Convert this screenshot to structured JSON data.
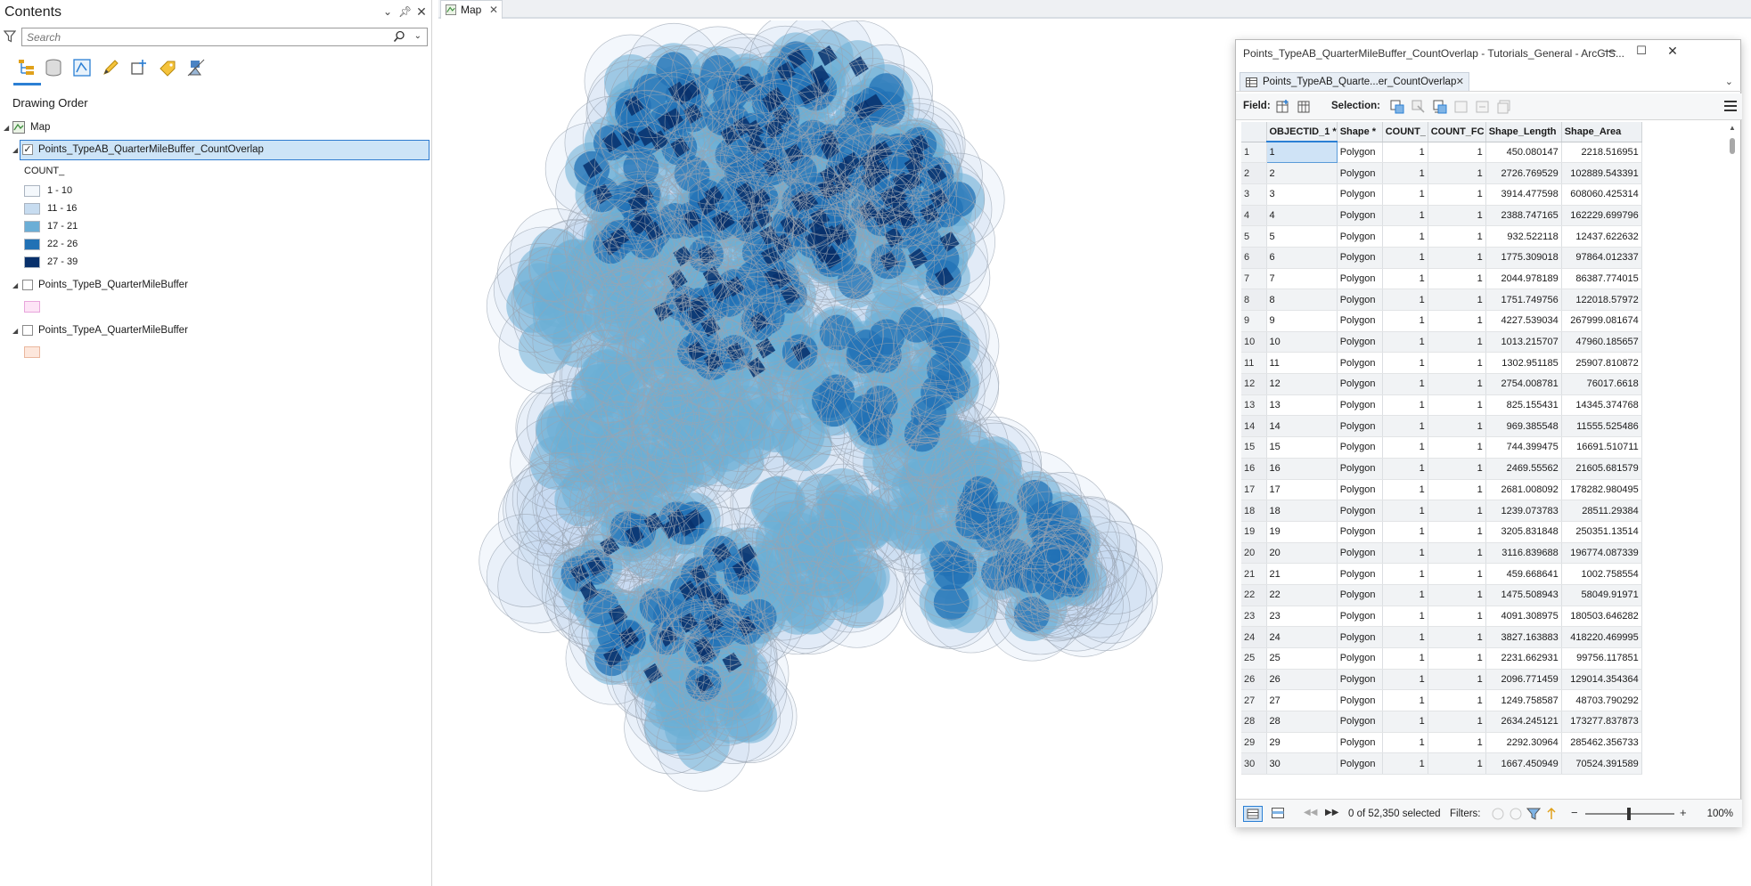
{
  "contents": {
    "title": "Contents",
    "search_placeholder": "Search",
    "section_heading": "Drawing Order",
    "map_label": "Map",
    "layers": [
      {
        "name": "Points_TypeAB_QuarterMileBuffer_CountOverlap",
        "checked": true,
        "selected": true
      },
      {
        "name": "Points_TypeB_QuarterMileBuffer",
        "checked": false,
        "swatch": "#fde4f6"
      },
      {
        "name": "Points_TypeA_QuarterMileBuffer",
        "checked": false,
        "swatch": "#fde7dc"
      }
    ],
    "legend_field": "COUNT_",
    "legend": [
      {
        "label": "1 - 10",
        "color": "#f4f8fc"
      },
      {
        "label": "11 - 16",
        "color": "#c7dcf0"
      },
      {
        "label": "17 - 21",
        "color": "#6baed6"
      },
      {
        "label": "22 - 26",
        "color": "#2171b5"
      },
      {
        "label": "27 - 39",
        "color": "#08306b"
      }
    ]
  },
  "map": {
    "tab_label": "Map"
  },
  "attribute_window": {
    "title": "Points_TypeAB_QuarterMileBuffer_CountOverlap - Tutorials_General - ArcGIS...",
    "tab_label": "Points_TypeAB_Quarte...er_CountOverlap",
    "field_label": "Field:",
    "selection_label": "Selection:",
    "columns": [
      "",
      "OBJECTID_1 *",
      "Shape *",
      "COUNT_",
      "COUNT_FC",
      "Shape_Length",
      "Shape_Area"
    ],
    "rows": [
      [
        "1",
        "1",
        "Polygon",
        "1",
        "1",
        "450.080147",
        "2218.516951"
      ],
      [
        "2",
        "2",
        "Polygon",
        "1",
        "1",
        "2726.769529",
        "102889.543391"
      ],
      [
        "3",
        "3",
        "Polygon",
        "1",
        "1",
        "3914.477598",
        "608060.425314"
      ],
      [
        "4",
        "4",
        "Polygon",
        "1",
        "1",
        "2388.747165",
        "162229.699796"
      ],
      [
        "5",
        "5",
        "Polygon",
        "1",
        "1",
        "932.522118",
        "12437.622632"
      ],
      [
        "6",
        "6",
        "Polygon",
        "1",
        "1",
        "1775.309018",
        "97864.012337"
      ],
      [
        "7",
        "7",
        "Polygon",
        "1",
        "1",
        "2044.978189",
        "86387.774015"
      ],
      [
        "8",
        "8",
        "Polygon",
        "1",
        "1",
        "1751.749756",
        "122018.57972"
      ],
      [
        "9",
        "9",
        "Polygon",
        "1",
        "1",
        "4227.539034",
        "267999.081674"
      ],
      [
        "10",
        "10",
        "Polygon",
        "1",
        "1",
        "1013.215707",
        "47960.185657"
      ],
      [
        "11",
        "11",
        "Polygon",
        "1",
        "1",
        "1302.951185",
        "25907.810872"
      ],
      [
        "12",
        "12",
        "Polygon",
        "1",
        "1",
        "2754.008781",
        "76017.6618"
      ],
      [
        "13",
        "13",
        "Polygon",
        "1",
        "1",
        "825.155431",
        "14345.374768"
      ],
      [
        "14",
        "14",
        "Polygon",
        "1",
        "1",
        "969.385548",
        "11555.525486"
      ],
      [
        "15",
        "15",
        "Polygon",
        "1",
        "1",
        "744.399475",
        "16691.510711"
      ],
      [
        "16",
        "16",
        "Polygon",
        "1",
        "1",
        "2469.55562",
        "21605.681579"
      ],
      [
        "17",
        "17",
        "Polygon",
        "1",
        "1",
        "2681.008092",
        "178282.980495"
      ],
      [
        "18",
        "18",
        "Polygon",
        "1",
        "1",
        "1239.073783",
        "28511.29384"
      ],
      [
        "19",
        "19",
        "Polygon",
        "1",
        "1",
        "3205.831848",
        "250351.13514"
      ],
      [
        "20",
        "20",
        "Polygon",
        "1",
        "1",
        "3116.839688",
        "196774.087339"
      ],
      [
        "21",
        "21",
        "Polygon",
        "1",
        "1",
        "459.668641",
        "1002.758554"
      ],
      [
        "22",
        "22",
        "Polygon",
        "1",
        "1",
        "1475.508943",
        "58049.91971"
      ],
      [
        "23",
        "23",
        "Polygon",
        "1",
        "1",
        "4091.308975",
        "180503.646282"
      ],
      [
        "24",
        "24",
        "Polygon",
        "1",
        "1",
        "3827.163883",
        "418220.469995"
      ],
      [
        "25",
        "25",
        "Polygon",
        "1",
        "1",
        "2231.662931",
        "99756.117851"
      ],
      [
        "26",
        "26",
        "Polygon",
        "1",
        "1",
        "2096.771459",
        "129014.354364"
      ],
      [
        "27",
        "27",
        "Polygon",
        "1",
        "1",
        "1249.758587",
        "48703.790292"
      ],
      [
        "28",
        "28",
        "Polygon",
        "1",
        "1",
        "2634.245121",
        "173277.837873"
      ],
      [
        "29",
        "29",
        "Polygon",
        "1",
        "1",
        "2292.30964",
        "285462.356733"
      ],
      [
        "30",
        "30",
        "Polygon",
        "1",
        "1",
        "1667.450949",
        "70524.391589"
      ]
    ],
    "status": "0 of 52,350 selected",
    "filters_label": "Filters:",
    "zoom": "100%"
  }
}
